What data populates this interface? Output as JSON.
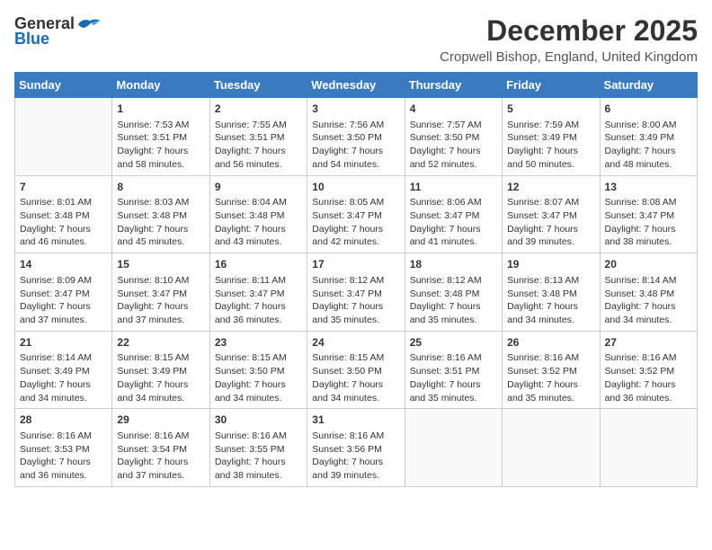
{
  "header": {
    "logo_general": "General",
    "logo_blue": "Blue",
    "title": "December 2025",
    "location": "Cropwell Bishop, England, United Kingdom"
  },
  "days_of_week": [
    "Sunday",
    "Monday",
    "Tuesday",
    "Wednesday",
    "Thursday",
    "Friday",
    "Saturday"
  ],
  "weeks": [
    [
      {
        "day": "",
        "sunrise": "",
        "sunset": "",
        "daylight": "",
        "empty": true
      },
      {
        "day": "1",
        "sunrise": "Sunrise: 7:53 AM",
        "sunset": "Sunset: 3:51 PM",
        "daylight": "Daylight: 7 hours and 58 minutes."
      },
      {
        "day": "2",
        "sunrise": "Sunrise: 7:55 AM",
        "sunset": "Sunset: 3:51 PM",
        "daylight": "Daylight: 7 hours and 56 minutes."
      },
      {
        "day": "3",
        "sunrise": "Sunrise: 7:56 AM",
        "sunset": "Sunset: 3:50 PM",
        "daylight": "Daylight: 7 hours and 54 minutes."
      },
      {
        "day": "4",
        "sunrise": "Sunrise: 7:57 AM",
        "sunset": "Sunset: 3:50 PM",
        "daylight": "Daylight: 7 hours and 52 minutes."
      },
      {
        "day": "5",
        "sunrise": "Sunrise: 7:59 AM",
        "sunset": "Sunset: 3:49 PM",
        "daylight": "Daylight: 7 hours and 50 minutes."
      },
      {
        "day": "6",
        "sunrise": "Sunrise: 8:00 AM",
        "sunset": "Sunset: 3:49 PM",
        "daylight": "Daylight: 7 hours and 48 minutes."
      }
    ],
    [
      {
        "day": "7",
        "sunrise": "Sunrise: 8:01 AM",
        "sunset": "Sunset: 3:48 PM",
        "daylight": "Daylight: 7 hours and 46 minutes."
      },
      {
        "day": "8",
        "sunrise": "Sunrise: 8:03 AM",
        "sunset": "Sunset: 3:48 PM",
        "daylight": "Daylight: 7 hours and 45 minutes."
      },
      {
        "day": "9",
        "sunrise": "Sunrise: 8:04 AM",
        "sunset": "Sunset: 3:48 PM",
        "daylight": "Daylight: 7 hours and 43 minutes."
      },
      {
        "day": "10",
        "sunrise": "Sunrise: 8:05 AM",
        "sunset": "Sunset: 3:47 PM",
        "daylight": "Daylight: 7 hours and 42 minutes."
      },
      {
        "day": "11",
        "sunrise": "Sunrise: 8:06 AM",
        "sunset": "Sunset: 3:47 PM",
        "daylight": "Daylight: 7 hours and 41 minutes."
      },
      {
        "day": "12",
        "sunrise": "Sunrise: 8:07 AM",
        "sunset": "Sunset: 3:47 PM",
        "daylight": "Daylight: 7 hours and 39 minutes."
      },
      {
        "day": "13",
        "sunrise": "Sunrise: 8:08 AM",
        "sunset": "Sunset: 3:47 PM",
        "daylight": "Daylight: 7 hours and 38 minutes."
      }
    ],
    [
      {
        "day": "14",
        "sunrise": "Sunrise: 8:09 AM",
        "sunset": "Sunset: 3:47 PM",
        "daylight": "Daylight: 7 hours and 37 minutes."
      },
      {
        "day": "15",
        "sunrise": "Sunrise: 8:10 AM",
        "sunset": "Sunset: 3:47 PM",
        "daylight": "Daylight: 7 hours and 37 minutes."
      },
      {
        "day": "16",
        "sunrise": "Sunrise: 8:11 AM",
        "sunset": "Sunset: 3:47 PM",
        "daylight": "Daylight: 7 hours and 36 minutes."
      },
      {
        "day": "17",
        "sunrise": "Sunrise: 8:12 AM",
        "sunset": "Sunset: 3:47 PM",
        "daylight": "Daylight: 7 hours and 35 minutes."
      },
      {
        "day": "18",
        "sunrise": "Sunrise: 8:12 AM",
        "sunset": "Sunset: 3:48 PM",
        "daylight": "Daylight: 7 hours and 35 minutes."
      },
      {
        "day": "19",
        "sunrise": "Sunrise: 8:13 AM",
        "sunset": "Sunset: 3:48 PM",
        "daylight": "Daylight: 7 hours and 34 minutes."
      },
      {
        "day": "20",
        "sunrise": "Sunrise: 8:14 AM",
        "sunset": "Sunset: 3:48 PM",
        "daylight": "Daylight: 7 hours and 34 minutes."
      }
    ],
    [
      {
        "day": "21",
        "sunrise": "Sunrise: 8:14 AM",
        "sunset": "Sunset: 3:49 PM",
        "daylight": "Daylight: 7 hours and 34 minutes."
      },
      {
        "day": "22",
        "sunrise": "Sunrise: 8:15 AM",
        "sunset": "Sunset: 3:49 PM",
        "daylight": "Daylight: 7 hours and 34 minutes."
      },
      {
        "day": "23",
        "sunrise": "Sunrise: 8:15 AM",
        "sunset": "Sunset: 3:50 PM",
        "daylight": "Daylight: 7 hours and 34 minutes."
      },
      {
        "day": "24",
        "sunrise": "Sunrise: 8:15 AM",
        "sunset": "Sunset: 3:50 PM",
        "daylight": "Daylight: 7 hours and 34 minutes."
      },
      {
        "day": "25",
        "sunrise": "Sunrise: 8:16 AM",
        "sunset": "Sunset: 3:51 PM",
        "daylight": "Daylight: 7 hours and 35 minutes."
      },
      {
        "day": "26",
        "sunrise": "Sunrise: 8:16 AM",
        "sunset": "Sunset: 3:52 PM",
        "daylight": "Daylight: 7 hours and 35 minutes."
      },
      {
        "day": "27",
        "sunrise": "Sunrise: 8:16 AM",
        "sunset": "Sunset: 3:52 PM",
        "daylight": "Daylight: 7 hours and 36 minutes."
      }
    ],
    [
      {
        "day": "28",
        "sunrise": "Sunrise: 8:16 AM",
        "sunset": "Sunset: 3:53 PM",
        "daylight": "Daylight: 7 hours and 36 minutes."
      },
      {
        "day": "29",
        "sunrise": "Sunrise: 8:16 AM",
        "sunset": "Sunset: 3:54 PM",
        "daylight": "Daylight: 7 hours and 37 minutes."
      },
      {
        "day": "30",
        "sunrise": "Sunrise: 8:16 AM",
        "sunset": "Sunset: 3:55 PM",
        "daylight": "Daylight: 7 hours and 38 minutes."
      },
      {
        "day": "31",
        "sunrise": "Sunrise: 8:16 AM",
        "sunset": "Sunset: 3:56 PM",
        "daylight": "Daylight: 7 hours and 39 minutes."
      },
      {
        "day": "",
        "sunrise": "",
        "sunset": "",
        "daylight": "",
        "empty": true
      },
      {
        "day": "",
        "sunrise": "",
        "sunset": "",
        "daylight": "",
        "empty": true
      },
      {
        "day": "",
        "sunrise": "",
        "sunset": "",
        "daylight": "",
        "empty": true
      }
    ]
  ]
}
